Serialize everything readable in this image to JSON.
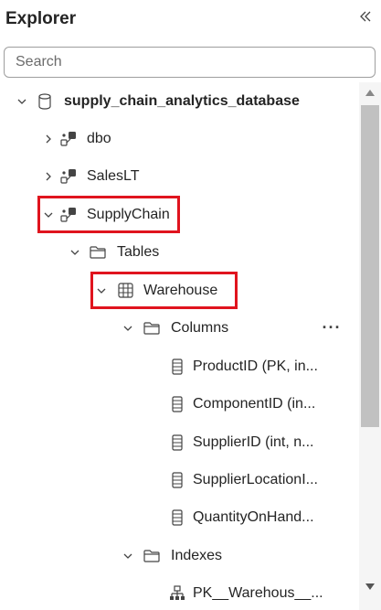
{
  "header": {
    "title": "Explorer",
    "collapse_icon": "double-chevron-left-icon"
  },
  "search": {
    "placeholder": "Search",
    "value": ""
  },
  "tree": {
    "database": {
      "label": "supply_chain_analytics_database",
      "icon": "database-icon",
      "expanded": true
    },
    "schemas": [
      {
        "label": "dbo",
        "icon": "schema-icon",
        "expanded": false
      },
      {
        "label": "SalesLT",
        "icon": "schema-icon",
        "expanded": false
      },
      {
        "label": "SupplyChain",
        "icon": "schema-icon",
        "expanded": true
      }
    ],
    "tables_folder": {
      "label": "Tables",
      "icon": "folder-icon",
      "expanded": true
    },
    "table": {
      "label": "Warehouse",
      "icon": "table-icon",
      "expanded": true
    },
    "columns_folder": {
      "label": "Columns",
      "icon": "folder-icon",
      "expanded": true,
      "more_label": "···"
    },
    "columns": [
      {
        "label": "ProductID (PK, in...",
        "icon": "column-icon"
      },
      {
        "label": "ComponentID (in...",
        "icon": "column-icon"
      },
      {
        "label": "SupplierID (int, n...",
        "icon": "column-icon"
      },
      {
        "label": "SupplierLocationI...",
        "icon": "column-icon"
      },
      {
        "label": "QuantityOnHand...",
        "icon": "column-icon"
      }
    ],
    "indexes_folder": {
      "label": "Indexes",
      "icon": "folder-icon",
      "expanded": true
    },
    "indexes": [
      {
        "label": "PK__Warehous__...",
        "icon": "index-icon"
      }
    ]
  },
  "colors": {
    "highlight": "#e0141e",
    "scroll_thumb": "#c1c1c1",
    "scroll_track": "#f5f5f5",
    "text": "#242424"
  }
}
